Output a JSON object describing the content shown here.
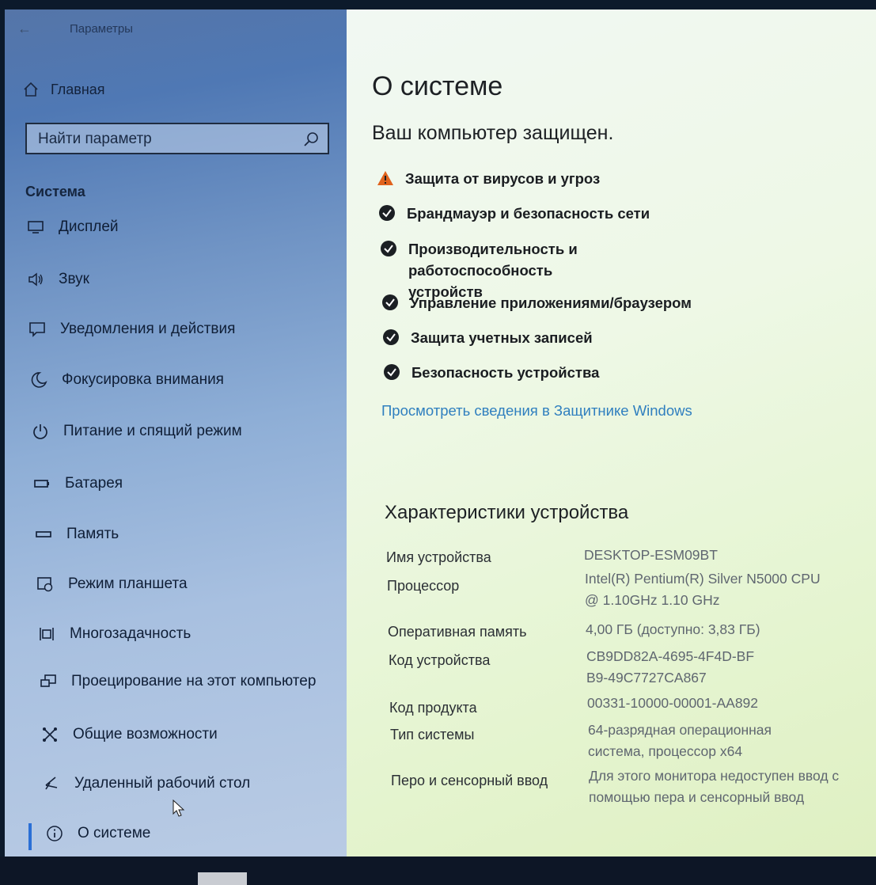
{
  "window": {
    "title": "Параметры",
    "back_label": "←"
  },
  "sidebar": {
    "home_label": "Главная",
    "search_placeholder": "Найти параметр",
    "section_title": "Система",
    "items": [
      {
        "label": "Дисплей",
        "icon": "display-icon"
      },
      {
        "label": "Звук",
        "icon": "sound-icon"
      },
      {
        "label": "Уведомления и действия",
        "icon": "notifications-icon"
      },
      {
        "label": "Фокусировка внимания",
        "icon": "moon-icon"
      },
      {
        "label": "Питание и спящий режим",
        "icon": "power-icon"
      },
      {
        "label": "Батарея",
        "icon": "battery-icon"
      },
      {
        "label": "Память",
        "icon": "storage-icon"
      },
      {
        "label": "Режим планшета",
        "icon": "tablet-icon"
      },
      {
        "label": "Многозадачность",
        "icon": "multitask-icon"
      },
      {
        "label": "Проецирование на этот компьютер",
        "icon": "project-icon"
      },
      {
        "label": "Общие возможности",
        "icon": "shared-icon"
      },
      {
        "label": "Удаленный рабочий стол",
        "icon": "remote-icon"
      },
      {
        "label": "О системе",
        "icon": "info-icon",
        "active": true
      }
    ]
  },
  "main": {
    "title": "О системе",
    "protection_title": "Ваш компьютер защищен.",
    "security_items": [
      {
        "label": "Защита от вирусов и угроз",
        "status": "warning"
      },
      {
        "label": "Брандмауэр и безопасность сети",
        "status": "ok"
      },
      {
        "label": "Производительность и работоспособность устройств",
        "status": "ok"
      },
      {
        "label": "Управление приложениями/браузером",
        "status": "ok"
      },
      {
        "label": "Защита учетных записей",
        "status": "ok"
      },
      {
        "label": "Безопасность устройства",
        "status": "ok"
      }
    ],
    "defender_link": "Просмотреть сведения в Защитнике Windows",
    "specs_title": "Характеристики устройства",
    "specs": [
      {
        "label": "Имя устройства",
        "value": "DESKTOP-ESM09BT"
      },
      {
        "label": "Процессор",
        "value": "Intel(R) Pentium(R) Silver N5000 CPU @ 1.10GHz 1.10 GHz"
      },
      {
        "label": "Оперативная память",
        "value": "4,00 ГБ (доступно: 3,83 ГБ)"
      },
      {
        "label": "Код устройства",
        "value": "CB9DD82A-4695-4F4D-BFB9-49C7727CA867"
      },
      {
        "label": "Код продукта",
        "value": "00331-10000-00001-AA892"
      },
      {
        "label": "Тип системы",
        "value": "64-разрядная операционная система, процессор x64"
      },
      {
        "label": "Перо и сенсорный ввод",
        "value": "Для этого монитора недоступен ввод с помощью пера и сенсорный ввод"
      }
    ]
  },
  "colors": {
    "accent": "#2a6fd6",
    "warning": "#e0621c",
    "ok": "#1b1f23",
    "link": "#2f7fbf"
  }
}
